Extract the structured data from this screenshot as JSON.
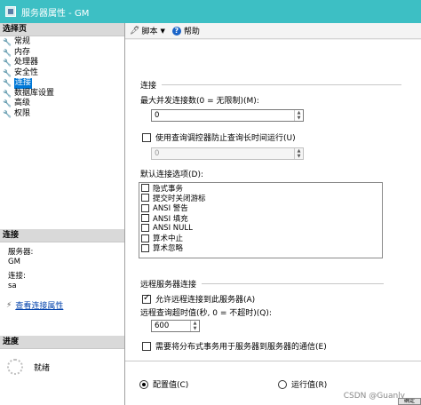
{
  "window": {
    "title": "服务器属性 - GM"
  },
  "left": {
    "select_page_header": "选择页",
    "nav": [
      {
        "label": "常规"
      },
      {
        "label": "内存"
      },
      {
        "label": "处理器"
      },
      {
        "label": "安全性"
      },
      {
        "label": "连接",
        "selected": true
      },
      {
        "label": "数据库设置"
      },
      {
        "label": "高级"
      },
      {
        "label": "权限"
      }
    ],
    "connection_header": "连接",
    "server_label": "服务器:",
    "server_value": "GM",
    "conn_label": "连接:",
    "conn_value": "sa",
    "view_conn_props": "查看连接属性",
    "progress_header": "进度",
    "progress_status": "就绪"
  },
  "toolbar": {
    "script_label": "脚本",
    "help_label": "帮助"
  },
  "connections": {
    "group_title": "连接",
    "max_conn_label": "最大并发连接数(0 = 无限制)(M):",
    "max_conn_value": "0",
    "query_governor_label": "使用查询调控器防止查询长时间运行(U)",
    "query_governor_checked": false,
    "query_governor_value": "0",
    "default_options_label": "默认连接选项(D):",
    "default_options": [
      {
        "label": "隐式事务",
        "checked": false
      },
      {
        "label": "提交时关闭游标",
        "checked": false
      },
      {
        "label": "ANSI 警告",
        "checked": false
      },
      {
        "label": "ANSI 填充",
        "checked": false
      },
      {
        "label": "ANSI NULL",
        "checked": false
      },
      {
        "label": "算术中止",
        "checked": false
      },
      {
        "label": "算术忽略",
        "checked": false
      }
    ]
  },
  "remote": {
    "group_title": "远程服务器连接",
    "allow_remote_label": "允许远程连接到此服务器(A)",
    "allow_remote_checked": true,
    "timeout_label": "远程查询超时值(秒, 0 = 不超时)(Q):",
    "timeout_value": "600",
    "dist_tx_label": "需要将分布式事务用于服务器到服务器的通信(E)",
    "dist_tx_checked": false
  },
  "values_mode": {
    "configured_label": "配置值(C)",
    "running_label": "运行值(R)",
    "selected": "configured"
  },
  "watermark": "CSDN @Guanly",
  "corner_button_label": "确定",
  "colors": {
    "titlebar": "#3dbfc4",
    "selection": "#0078d7",
    "link": "#0645ad"
  }
}
